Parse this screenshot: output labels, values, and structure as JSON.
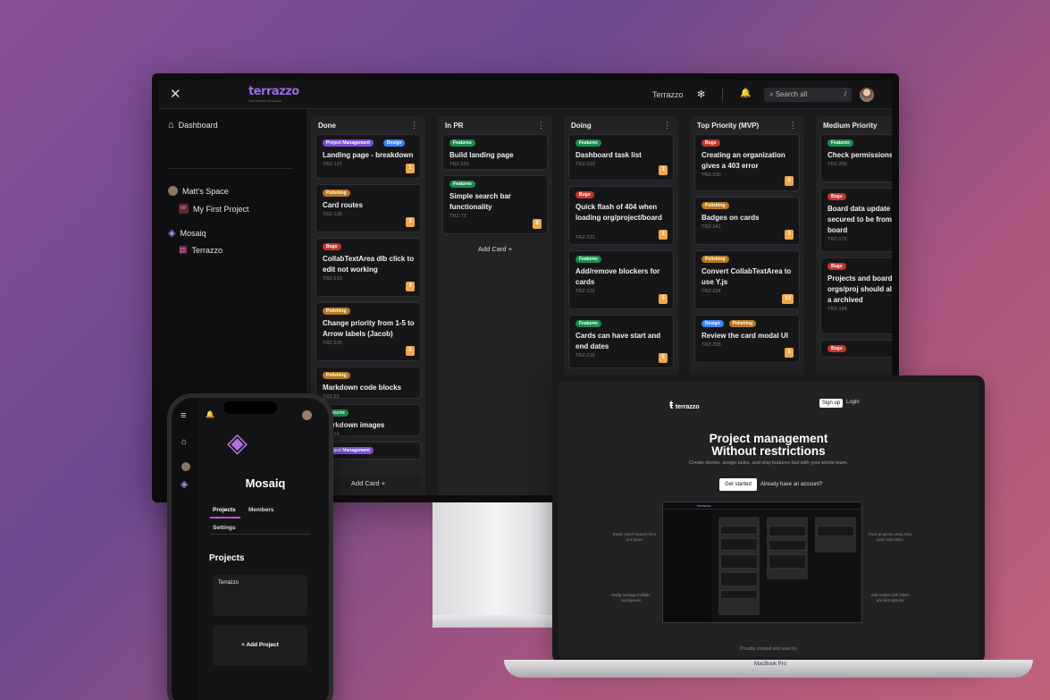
{
  "desktop": {
    "logo": "terrazzo",
    "logo_sub": "THE PROJECT MANAGER",
    "workspace": "Terrazzo",
    "search_placeholder": "Search all",
    "search_shortcut": "/",
    "sidebar": {
      "dashboard": "Dashboard",
      "space": "Matt's Space",
      "space_project_initials": "MF",
      "space_project": "My First Project",
      "org": "Mosaiq",
      "org_project": "Terrazzo"
    },
    "columns": [
      {
        "title": "Done",
        "add_label": "Add Card +",
        "cards": [
          {
            "tags": [
              "Project Management",
              "Design"
            ],
            "title": "Landing page - breakdown",
            "id": "TRZ-137",
            "pts": "1"
          },
          {
            "tags": [
              "Polishing"
            ],
            "title": "Card routes",
            "id": "TRZ-136",
            "pts": "3"
          },
          {
            "tags": [
              "Bugs"
            ],
            "title": "CollabTextArea dlb click to edit not working",
            "id": "TRZ-213",
            "pts": "3"
          },
          {
            "tags": [
              "Polishing"
            ],
            "title": "Change priority from 1-5 to Arrow labels (Jacob)",
            "id": "TRZ-225",
            "pts": "3"
          },
          {
            "tags": [
              "Polishing"
            ],
            "title": "Markdown code blocks",
            "id": "TRZ-92",
            "pts": ""
          },
          {
            "tags": [
              "Features"
            ],
            "title": "Markdown images",
            "id": "TRZ-94",
            "pts": ""
          },
          {
            "tags": [
              "Project Management"
            ],
            "title": "",
            "id": "",
            "pts": ""
          }
        ]
      },
      {
        "title": "In PR",
        "add_label": "Add Card +",
        "cards": [
          {
            "tags": [
              "Features"
            ],
            "title": "Build landing page",
            "id": "TRZ-233",
            "pts": ""
          },
          {
            "tags": [
              "Features"
            ],
            "title": "Simple search bar functionality",
            "id": "TRZ-73",
            "pts": "8"
          }
        ]
      },
      {
        "title": "Doing",
        "add_label": "",
        "cards": [
          {
            "tags": [
              "Features"
            ],
            "title": "Dashboard task list",
            "id": "TRZ-223",
            "pts": "3"
          },
          {
            "tags": [
              "Bugs"
            ],
            "title": "Quick flash of 404 when loading org/project/board",
            "id": "TRZ-221",
            "pts": "2"
          },
          {
            "tags": [
              "Features"
            ],
            "title": "Add/remove blockers for cards",
            "id": "TRZ-122",
            "pts": "5"
          },
          {
            "tags": [
              "Features"
            ],
            "title": "Cards can have start and end dates",
            "id": "TRZ-218",
            "pts": "5"
          }
        ]
      },
      {
        "title": "Top Priority (MVP)",
        "add_label": "",
        "cards": [
          {
            "tags": [
              "Bugs"
            ],
            "title": "Creating an organization gives a 403 error",
            "id": "TRZ-230",
            "pts": "3"
          },
          {
            "tags": [
              "Polishing"
            ],
            "title": "Badges on cards",
            "id": "TRZ-141",
            "pts": "3"
          },
          {
            "tags": [
              "Polishing"
            ],
            "title": "Convert CollabTextArea to use Y.js",
            "id": "TRZ-224",
            "pts": "13"
          },
          {
            "tags": [
              "Design",
              "Polishing"
            ],
            "title": "Review the card modal UI",
            "id": "TRZ-226",
            "pts": "3"
          }
        ]
      },
      {
        "title": "Medium Priority",
        "add_label": "",
        "cards": [
          {
            "tags": [
              "Features"
            ],
            "title": "Check permissions events",
            "id": "TRZ-256",
            "pts": ""
          },
          {
            "tags": [
              "Bugs"
            ],
            "title": "Board data update not secured to be from that board",
            "id": "TRZ-172",
            "pts": ""
          },
          {
            "tags": [
              "Bugs"
            ],
            "title": "Projects and board archived orgs/proj should also show a archived",
            "id": "TRZ-194",
            "pts": ""
          },
          {
            "tags": [
              "Bugs"
            ],
            "title": "",
            "id": "",
            "pts": ""
          }
        ]
      }
    ]
  },
  "tag_colors": {
    "Project Management": "#7b4fd6",
    "Design": "#3b82f6",
    "Polishing": "#b7791f",
    "Bugs": "#c0392b",
    "Features": "#1f8a4c"
  },
  "phone": {
    "org_name": "Mosaiq",
    "tab_projects": "Projects",
    "tab_members": "Members",
    "tab_settings": "Settings",
    "section_title": "Projects",
    "project_name": "Terrazzo",
    "add_project": "+ Add Project"
  },
  "laptop": {
    "brand": "terrazzo",
    "signup": "Sign up",
    "login": "Login",
    "hero_line1": "Project management",
    "hero_line2": "Without restrictions",
    "hero_sub": "Create stories, assign tasks, and ship features fast with your whole team.",
    "get_started": "Get started",
    "already_account": "Already have an account?",
    "note_left_1": "Easily switch spaces from one place",
    "note_left_2": "Easily manage multiple workspaces",
    "note_right_1": "Track progress using story point estimation",
    "note_right_2": "Add context with labels and descriptions",
    "footer": "Proudly created and used by",
    "model": "MacBook Pro"
  }
}
